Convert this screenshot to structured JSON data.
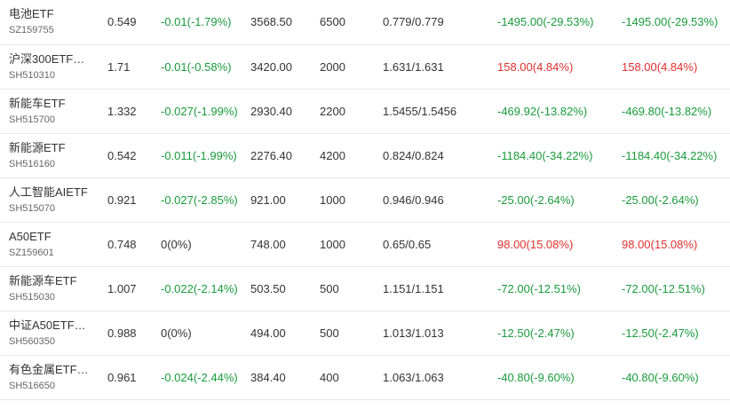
{
  "rows": [
    {
      "name": "电池ETF",
      "code": "SZ159755",
      "price": "0.549",
      "change": "-0.01(-1.79%)",
      "change_dir": "down",
      "value": "3568.50",
      "qty": "6500",
      "cost": "0.779/0.779",
      "pnl": "-1495.00(-29.53%)",
      "pnl_dir": "down",
      "pnl2": "-1495.00(-29.53%)",
      "pnl2_dir": "down"
    },
    {
      "name": "沪深300ETF…",
      "code": "SH510310",
      "price": "1.71",
      "change": "-0.01(-0.58%)",
      "change_dir": "down",
      "value": "3420.00",
      "qty": "2000",
      "cost": "1.631/1.631",
      "pnl": "158.00(4.84%)",
      "pnl_dir": "up",
      "pnl2": "158.00(4.84%)",
      "pnl2_dir": "up"
    },
    {
      "name": "新能车ETF",
      "code": "SH515700",
      "price": "1.332",
      "change": "-0.027(-1.99%)",
      "change_dir": "down",
      "value": "2930.40",
      "qty": "2200",
      "cost": "1.5455/1.5456",
      "pnl": "-469.92(-13.82%)",
      "pnl_dir": "down",
      "pnl2": "-469.80(-13.82%)",
      "pnl2_dir": "down"
    },
    {
      "name": "新能源ETF",
      "code": "SH516160",
      "price": "0.542",
      "change": "-0.011(-1.99%)",
      "change_dir": "down",
      "value": "2276.40",
      "qty": "4200",
      "cost": "0.824/0.824",
      "pnl": "-1184.40(-34.22%)",
      "pnl_dir": "down",
      "pnl2": "-1184.40(-34.22%)",
      "pnl2_dir": "down"
    },
    {
      "name": "人工智能AIETF",
      "code": "SH515070",
      "price": "0.921",
      "change": "-0.027(-2.85%)",
      "change_dir": "down",
      "value": "921.00",
      "qty": "1000",
      "cost": "0.946/0.946",
      "pnl": "-25.00(-2.64%)",
      "pnl_dir": "down",
      "pnl2": "-25.00(-2.64%)",
      "pnl2_dir": "down"
    },
    {
      "name": "A50ETF",
      "code": "SZ159601",
      "price": "0.748",
      "change": "0(0%)",
      "change_dir": "flat",
      "value": "748.00",
      "qty": "1000",
      "cost": "0.65/0.65",
      "pnl": "98.00(15.08%)",
      "pnl_dir": "up",
      "pnl2": "98.00(15.08%)",
      "pnl2_dir": "up"
    },
    {
      "name": "新能源车ETF",
      "code": "SH515030",
      "price": "1.007",
      "change": "-0.022(-2.14%)",
      "change_dir": "down",
      "value": "503.50",
      "qty": "500",
      "cost": "1.151/1.151",
      "pnl": "-72.00(-12.51%)",
      "pnl_dir": "down",
      "pnl2": "-72.00(-12.51%)",
      "pnl2_dir": "down"
    },
    {
      "name": "中证A50ETF…",
      "code": "SH560350",
      "price": "0.988",
      "change": "0(0%)",
      "change_dir": "flat",
      "value": "494.00",
      "qty": "500",
      "cost": "1.013/1.013",
      "pnl": "-12.50(-2.47%)",
      "pnl_dir": "down",
      "pnl2": "-12.50(-2.47%)",
      "pnl2_dir": "down"
    },
    {
      "name": "有色金属ETF…",
      "code": "SH516650",
      "price": "0.961",
      "change": "-0.024(-2.44%)",
      "change_dir": "down",
      "value": "384.40",
      "qty": "400",
      "cost": "1.063/1.063",
      "pnl": "-40.80(-9.60%)",
      "pnl_dir": "down",
      "pnl2": "-40.80(-9.60%)",
      "pnl2_dir": "down"
    }
  ],
  "colors": {
    "up": "#e0302e",
    "down": "#1a9b3c",
    "neutral": "#333333",
    "divider": "#e6e6e6"
  }
}
